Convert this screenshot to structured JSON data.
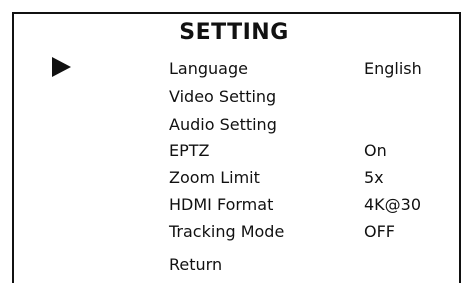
{
  "menu": {
    "title": "SETTING",
    "selected_index": 0,
    "items": [
      {
        "label": "Language",
        "value": "English"
      },
      {
        "label": "Video Setting",
        "value": ""
      },
      {
        "label": "Audio Setting",
        "value": ""
      },
      {
        "label": "EPTZ",
        "value": "On"
      },
      {
        "label": "Zoom Limit",
        "value": "5x"
      },
      {
        "label": "HDMI Format",
        "value": "4K@30"
      },
      {
        "label": "Tracking Mode",
        "value": "OFF"
      },
      {
        "label": "Return",
        "value": ""
      }
    ]
  },
  "colors": {
    "background": "#ffffff",
    "text": "#111111"
  },
  "icons": {
    "selector": "play-triangle-icon"
  }
}
